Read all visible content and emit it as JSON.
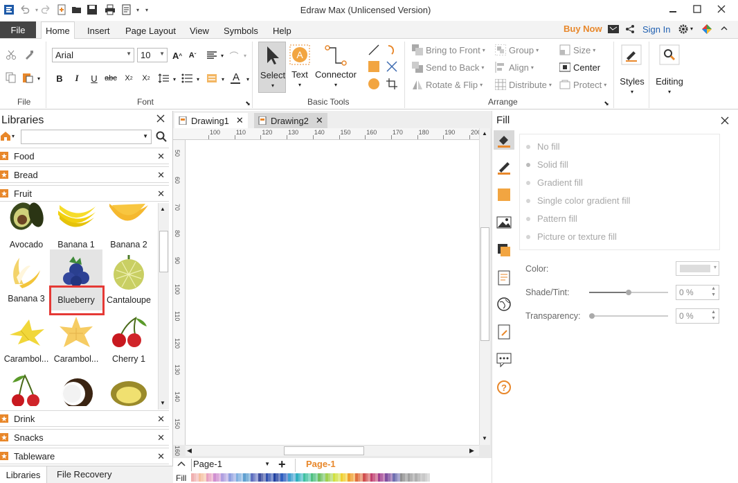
{
  "window": {
    "title": "Edraw Max (Unlicensed Version)"
  },
  "menu": {
    "file": "File",
    "tabs": [
      "Home",
      "Insert",
      "Page Layout",
      "View",
      "Symbols",
      "Help"
    ],
    "buy_now": "Buy Now",
    "sign_in": "Sign In"
  },
  "ribbon": {
    "font": {
      "family": "Arial",
      "size": "10",
      "group": "Font"
    },
    "file_group": "File",
    "basic_tools": {
      "select": "Select",
      "text": "Text",
      "connector": "Connector",
      "group": "Basic Tools"
    },
    "arrange": {
      "bring_to_front": "Bring to Front",
      "send_to_back": "Send to Back",
      "rotate_flip": "Rotate & Flip",
      "group": "Group",
      "align": "Align",
      "distribute": "Distribute",
      "size": "Size",
      "center": "Center",
      "protect": "Protect",
      "label": "Arrange"
    },
    "styles": "Styles",
    "editing": "Editing"
  },
  "libraries": {
    "title": "Libraries",
    "categories_top": [
      "Food",
      "Bread",
      "Fruit"
    ],
    "shapes": [
      {
        "label": "Avocado"
      },
      {
        "label": "Banana 1"
      },
      {
        "label": "Banana 2"
      },
      {
        "label": "Banana 3"
      },
      {
        "label": "Blueberry"
      },
      {
        "label": "Cantaloupe"
      },
      {
        "label": "Carambol..."
      },
      {
        "label": "Carambol..."
      },
      {
        "label": "Cherry 1"
      },
      {
        "label": ""
      },
      {
        "label": ""
      },
      {
        "label": ""
      }
    ],
    "categories_bottom": [
      "Drink",
      "Snacks",
      "Tableware"
    ],
    "bottom_tabs": [
      "Libraries",
      "File Recovery"
    ]
  },
  "documents": {
    "tabs": [
      "Drawing1",
      "Drawing2"
    ],
    "active": "Drawing2"
  },
  "rulers": {
    "h": [
      "100",
      "110",
      "120",
      "130",
      "140",
      "150",
      "160",
      "170",
      "180",
      "190",
      "200"
    ],
    "v": [
      "50",
      "60",
      "70",
      "80",
      "90",
      "100",
      "110",
      "120",
      "130",
      "140",
      "150",
      "160"
    ]
  },
  "pages": {
    "current": "Page-1",
    "tab": "Page-1",
    "fill_label": "Fill"
  },
  "fill_panel": {
    "title": "Fill",
    "options": [
      "No fill",
      "Solid fill",
      "Gradient fill",
      "Single color gradient fill",
      "Pattern fill",
      "Picture or texture fill"
    ],
    "color_label": "Color:",
    "shade_label": "Shade/Tint:",
    "shade_value": "0 %",
    "transparency_label": "Transparency:",
    "transparency_value": "0 %"
  },
  "colors": {
    "accent": "#e8872a",
    "file_tab": "#444444",
    "highlight": "#e53935"
  }
}
